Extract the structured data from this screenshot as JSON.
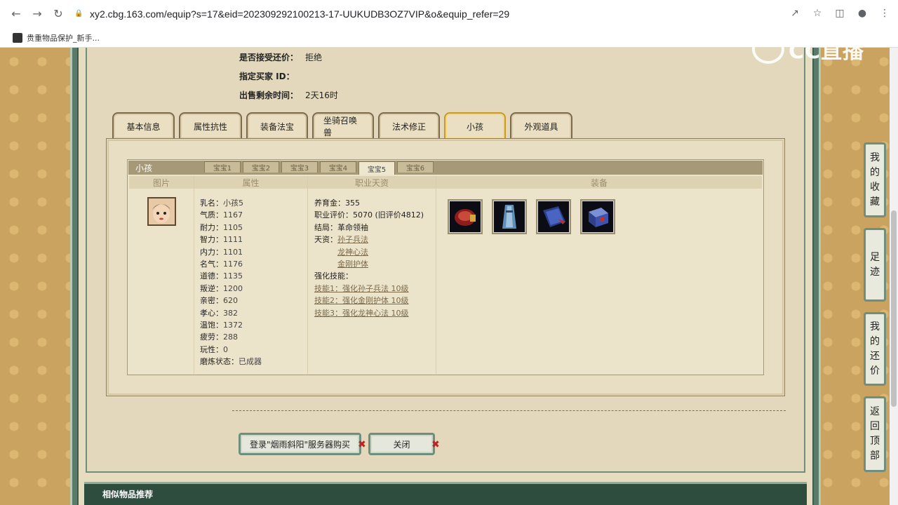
{
  "browser": {
    "url": "xy2.cbg.163.com/equip?s=17&eid=202309292100213-17-UUKUDB3OZ7VIP&o&equip_refer=29",
    "bookmark_label": "贵重物品保护_新手..."
  },
  "watermark": "CC直播",
  "seller": {
    "accept_offer_label": "是否接受还价：",
    "accept_offer_value": "拒绝",
    "buyer_id_label": "指定买家 ID：",
    "buyer_id_value": "",
    "time_left_label": "出售剩余时间：",
    "time_left_value": "2天16时"
  },
  "tabs": [
    "基本信息",
    "属性抗性",
    "装备法宝",
    "坐骑召唤兽",
    "法术修正",
    "小孩",
    "外观道具"
  ],
  "active_tab": "小孩",
  "child_panel": {
    "title": "小孩",
    "subtabs": [
      "宝宝1",
      "宝宝2",
      "宝宝3",
      "宝宝4",
      "宝宝5",
      "宝宝6"
    ],
    "active_subtab": "宝宝5",
    "columns": [
      "图片",
      "属性",
      "职业天资",
      "装备"
    ],
    "attributes": [
      {
        "k": "乳名：",
        "v": "小孩5"
      },
      {
        "k": "气质：",
        "v": "1167"
      },
      {
        "k": "耐力：",
        "v": "1105"
      },
      {
        "k": "智力：",
        "v": "1111"
      },
      {
        "k": "内力：",
        "v": "1101"
      },
      {
        "k": "名气：",
        "v": "1176"
      },
      {
        "k": "道德：",
        "v": "1135"
      },
      {
        "k": "叛逆：",
        "v": "1200"
      },
      {
        "k": "亲密：",
        "v": "620"
      },
      {
        "k": "孝心：",
        "v": "382"
      },
      {
        "k": "温饱：",
        "v": "1372"
      },
      {
        "k": "疲劳：",
        "v": "288"
      },
      {
        "k": "玩性：",
        "v": "0"
      },
      {
        "k": "磨炼状态：",
        "v": "已成器"
      }
    ],
    "career": {
      "upbringing_label": "养育金：",
      "upbringing_value": "355",
      "rating_label": "职业评价：",
      "rating_value": "5070 (旧评价4812)",
      "ending_label": "结局：",
      "ending_value": "革命领袖",
      "talent_label": "天资：",
      "talents": [
        "孙子兵法",
        "龙神心法",
        "金刚护体"
      ],
      "skills_label": "强化技能：",
      "skills": [
        "技能1：强化孙子兵法 10级",
        "技能2：强化金刚护体 10级",
        "技能3：强化龙神心法 10级"
      ]
    },
    "equip_icons": [
      "red-armor-icon",
      "blue-robe-icon",
      "blue-book-icon",
      "blue-chest-icon"
    ]
  },
  "buttons": {
    "login_buy": "登录\"烟雨斜阳\"服务器购买",
    "close": "关闭"
  },
  "similar_title": "相似物品推荐",
  "side_buttons": [
    [
      "我",
      "的",
      "收",
      "藏"
    ],
    [
      "足",
      "迹"
    ],
    [
      "我",
      "的",
      "还",
      "价"
    ],
    [
      "返",
      "回",
      "顶",
      "部"
    ]
  ]
}
